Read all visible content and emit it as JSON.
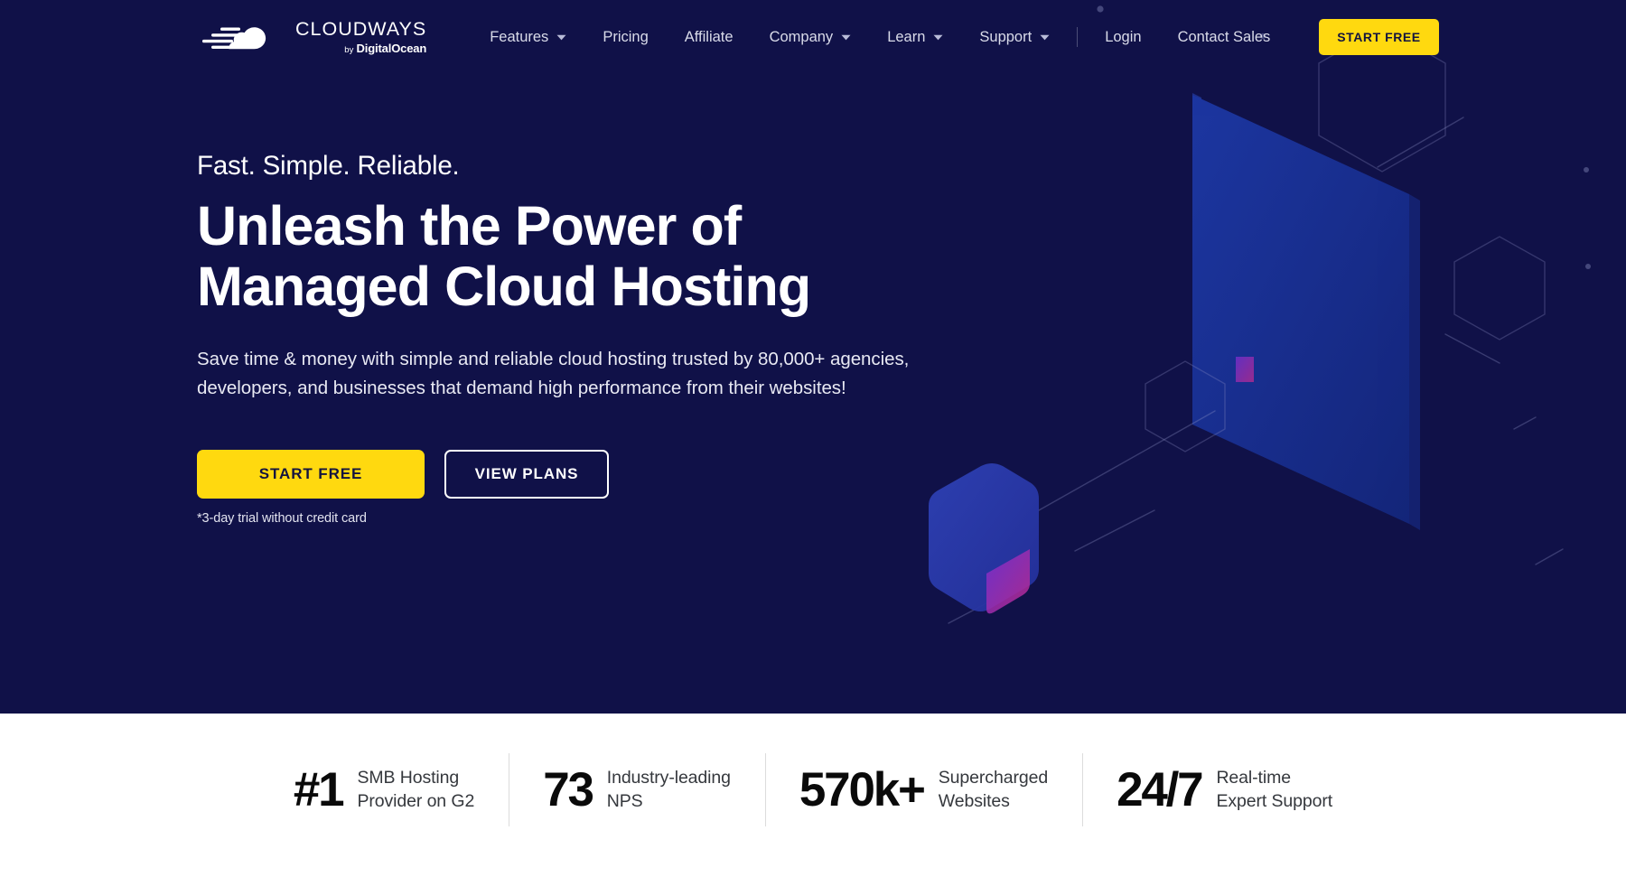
{
  "brand": {
    "accent_yellow": "#ffd90f",
    "navy": "#101148",
    "logo_word": "CLOUDWAYS",
    "logo_by": "by",
    "logo_parent": "DigitalOcean",
    "logo_icon": "cloud-speed-icon"
  },
  "header": {
    "nav_main": [
      {
        "label": "Features",
        "has_dropdown": true,
        "icon": "chevron-down-icon"
      },
      {
        "label": "Pricing",
        "has_dropdown": false,
        "icon": ""
      },
      {
        "label": "Affiliate",
        "has_dropdown": false,
        "icon": ""
      },
      {
        "label": "Company",
        "has_dropdown": true,
        "icon": "chevron-down-icon"
      },
      {
        "label": "Learn",
        "has_dropdown": true,
        "icon": "chevron-down-icon"
      }
    ],
    "nav_right": [
      {
        "label": "Support",
        "has_dropdown": true,
        "icon": "chevron-down-icon"
      },
      {
        "label": "Login",
        "has_dropdown": false,
        "icon": ""
      },
      {
        "label": "Contact Sales",
        "has_dropdown": false,
        "icon": ""
      }
    ],
    "cta_label": "START FREE"
  },
  "hero": {
    "eyebrow": "Fast. Simple. Reliable.",
    "headline": "Unleash the Power of Managed Cloud Hosting",
    "subcopy": "Save time & money with simple and reliable cloud hosting trusted by 80,000+ agencies, developers, and businesses that demand high performance from their websites!",
    "primary_cta": "START FREE",
    "secondary_cta": "VIEW PLANS",
    "trial_note": "*3-day trial without credit card"
  },
  "stats": [
    {
      "value": "#1",
      "label": "SMB Hosting\nProvider on G2"
    },
    {
      "value": "73",
      "label": "Industry-leading\nNPS"
    },
    {
      "value": "570k+",
      "label": "Supercharged\nWebsites"
    },
    {
      "value": "24/7",
      "label": "Real-time\nExpert Support"
    }
  ]
}
